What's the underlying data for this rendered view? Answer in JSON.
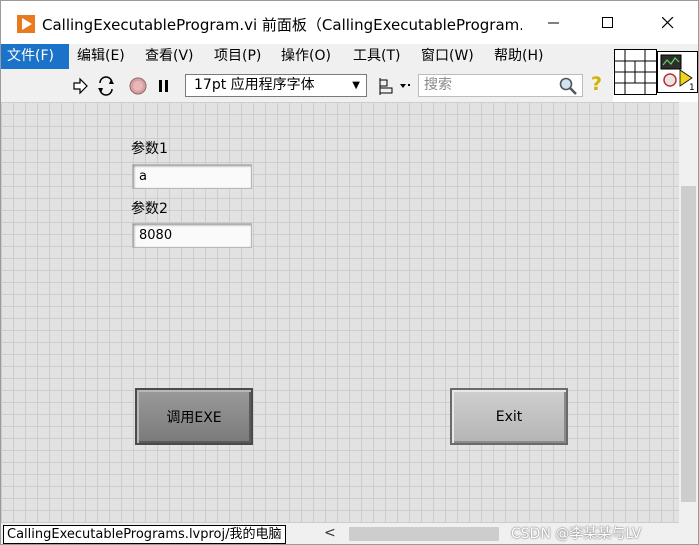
{
  "window": {
    "title": "CallingExecutableProgram.vi 前面板（CallingExecutableProgram...",
    "minimize": "—",
    "maximize": "☐",
    "close": "✕"
  },
  "menu": {
    "items": [
      {
        "label": "文件(F)"
      },
      {
        "label": "编辑(E)"
      },
      {
        "label": "查看(V)"
      },
      {
        "label": "项目(P)"
      },
      {
        "label": "操作(O)"
      },
      {
        "label": "工具(T)"
      },
      {
        "label": "窗口(W)"
      },
      {
        "label": "帮助(H)"
      }
    ]
  },
  "toolbar": {
    "font": "17pt 应用程序字体",
    "search_placeholder": "搜索",
    "help": "?"
  },
  "panel": {
    "param1_label": "参数1",
    "param1_value": "a",
    "param2_label": "参数2",
    "param2_value": "8080",
    "call_exe_label": "调用EXE",
    "exit_label": "Exit"
  },
  "status": {
    "project": "CallingExecutablePrograms.lvproj/我的电脑",
    "scroll_left": "<",
    "watermark": "CSDN @李某某与LV"
  },
  "colors": {
    "menu_active": "#1a73c8",
    "panel_bg": "#e2e2e2",
    "app_icon": "#e87b1f"
  }
}
